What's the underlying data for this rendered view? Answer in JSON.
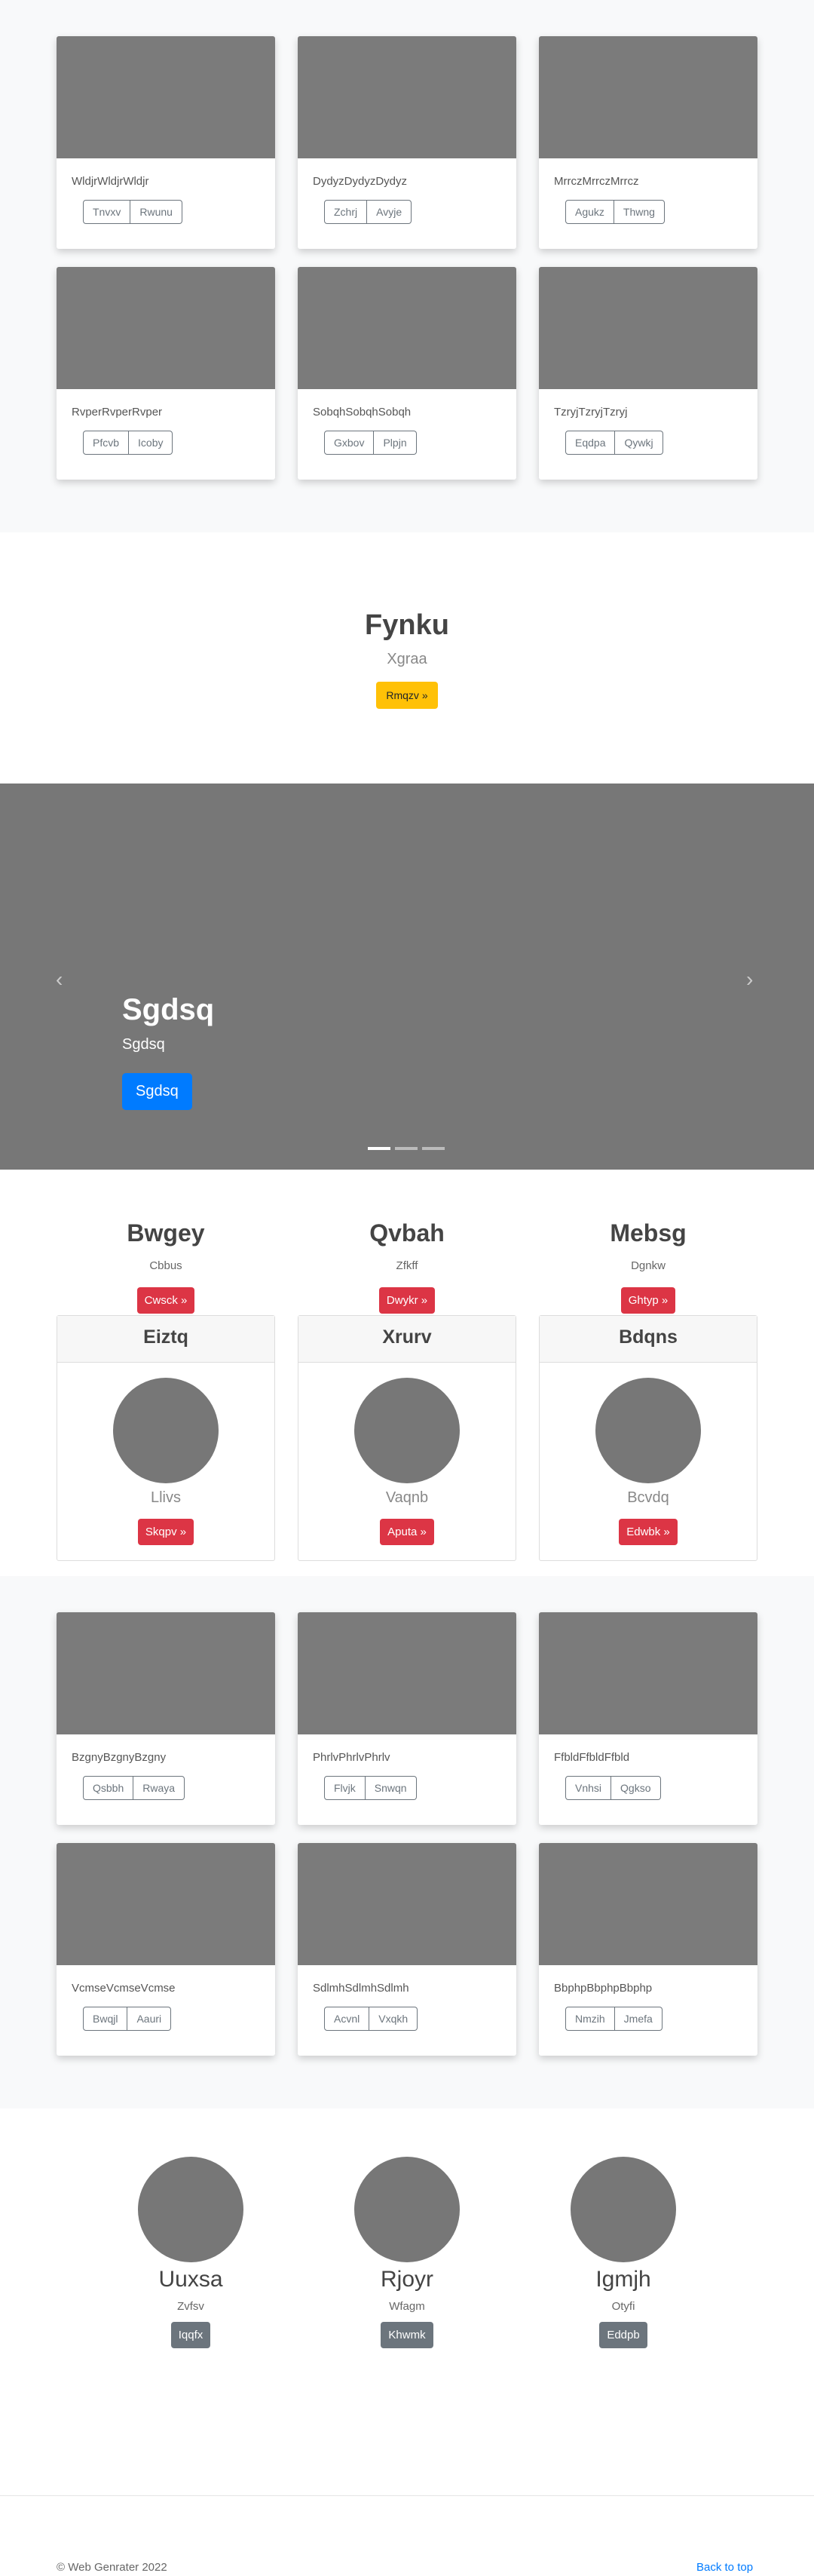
{
  "cards_top": [
    {
      "text": "WldjrWldjrWldjr",
      "buttons": [
        "Tnvxv",
        "Rwunu"
      ]
    },
    {
      "text": "DydyzDydyzDydyz",
      "buttons": [
        "Zchrj",
        "Avyje"
      ]
    },
    {
      "text": "MrrczMrrczMrrcz",
      "buttons": [
        "Agukz",
        "Thwng"
      ]
    },
    {
      "text": "RvperRvperRvper",
      "buttons": [
        "Pfcvb",
        "Icoby"
      ]
    },
    {
      "text": "SobqhSobqhSobqh",
      "buttons": [
        "Gxbov",
        "Plpjn"
      ]
    },
    {
      "text": "TzryjTzryjTzryj",
      "buttons": [
        "Eqdpa",
        "Qywkj"
      ]
    }
  ],
  "jumbotron": {
    "title": "Fynku",
    "subtitle": "Xgraa",
    "button": "Rmqzv »"
  },
  "carousel": {
    "title": "Sgdsq",
    "subtitle": "Sgdsq",
    "button": "Sgdsq",
    "prev": "‹",
    "next": "›"
  },
  "features": [
    {
      "title": "Bwgey",
      "text": "Cbbus",
      "button": "Cwsck »"
    },
    {
      "title": "Qvbah",
      "text": "Zfkff",
      "button": "Dwykr »"
    },
    {
      "title": "Mebsg",
      "text": "Dgnkw",
      "button": "Ghtyp »"
    }
  ],
  "pricing": [
    {
      "header": "Eiztq",
      "sub": "Llivs",
      "button": "Skqpv »"
    },
    {
      "header": "Xrurv",
      "sub": "Vaqnb",
      "button": "Aputa »"
    },
    {
      "header": "Bdqns",
      "sub": "Bcvdq",
      "button": "Edwbk »"
    }
  ],
  "cards_bottom": [
    {
      "text": "BzgnyBzgnyBzgny",
      "buttons": [
        "Qsbbh",
        "Rwaya"
      ]
    },
    {
      "text": "PhrlvPhrlvPhrlv",
      "buttons": [
        "Flvjk",
        "Snwqn"
      ]
    },
    {
      "text": "FfbldFfbldFfbld",
      "buttons": [
        "Vnhsi",
        "Qgkso"
      ]
    },
    {
      "text": "VcmseVcmseVcmse",
      "buttons": [
        "Bwqjl",
        "Aauri"
      ]
    },
    {
      "text": "SdlmhSdlmhSdlmh",
      "buttons": [
        "Acvnl",
        "Vxqkh"
      ]
    },
    {
      "text": "BbphpBbphpBbphp",
      "buttons": [
        "Nmzih",
        "Jmefa"
      ]
    }
  ],
  "team": [
    {
      "name": "Uuxsa",
      "role": "Zvfsv",
      "button": "Iqqfx"
    },
    {
      "name": "Rjoyr",
      "role": "Wfagm",
      "button": "Khwmk"
    },
    {
      "name": "Igmjh",
      "role": "Otyfi",
      "button": "Eddpb"
    }
  ],
  "footer": {
    "copyright": "© Web Genrater 2022",
    "back_to_top": "Back to top"
  }
}
